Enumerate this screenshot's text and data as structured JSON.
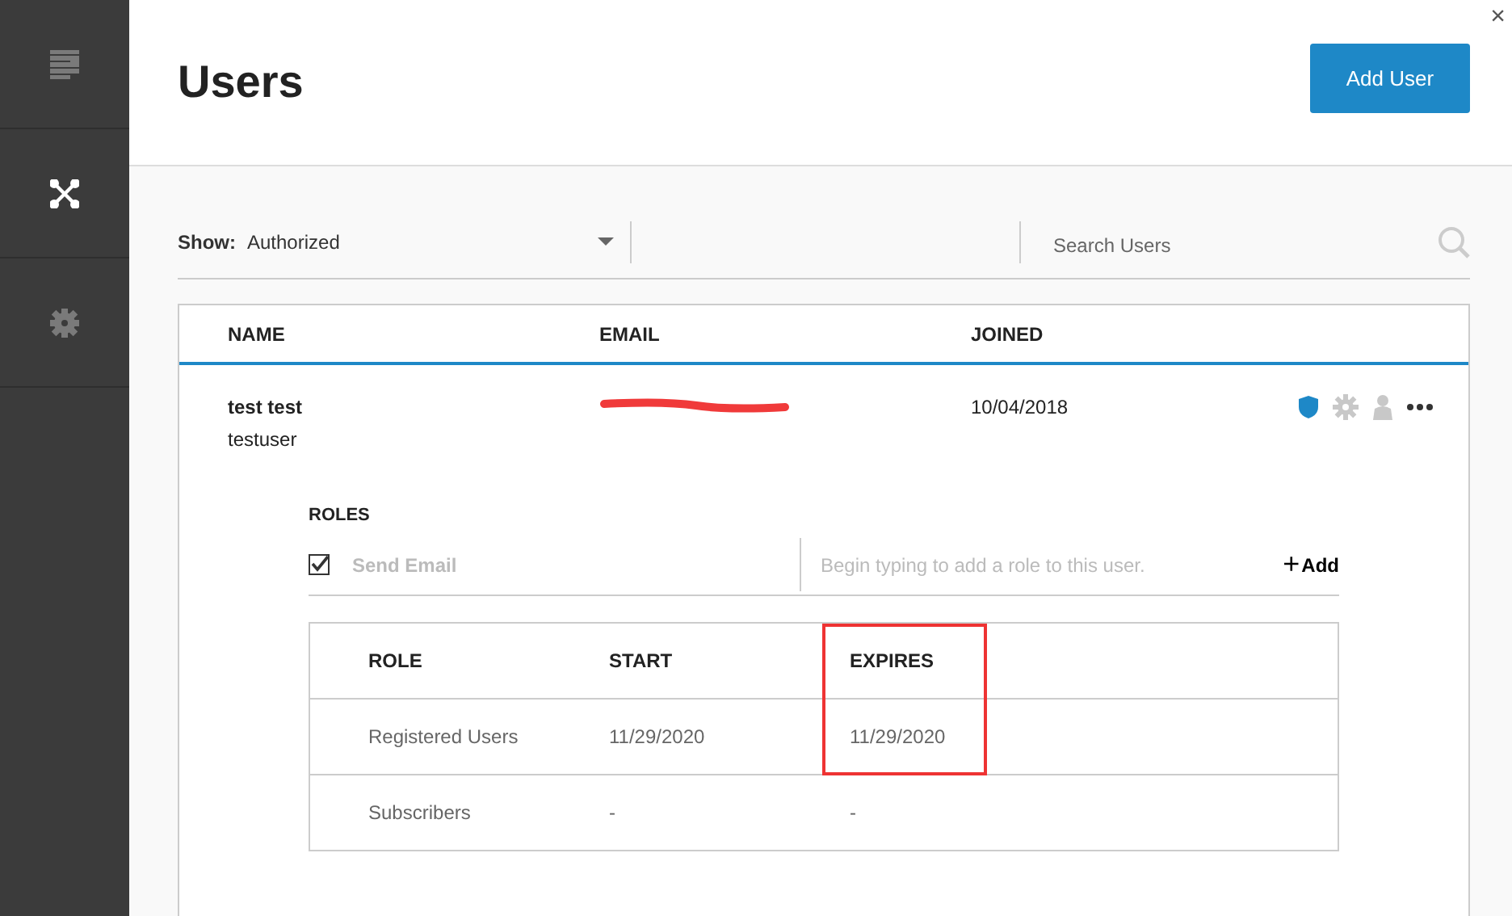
{
  "sidebar": {
    "items": [
      {
        "selected": false
      },
      {
        "selected": true
      },
      {
        "selected": false
      }
    ]
  },
  "header": {
    "title": "Users",
    "add_button": "Add User",
    "close": "×"
  },
  "filter": {
    "label": "Show:",
    "value": "Authorized",
    "search_placeholder": "Search Users"
  },
  "users_table": {
    "columns": [
      "NAME",
      "EMAIL",
      "JOINED"
    ],
    "rows": [
      {
        "name": "test test",
        "username": "testuser",
        "email_redacted": true,
        "joined": "10/04/2018",
        "expanded": true
      }
    ]
  },
  "roles": {
    "title": "ROLES",
    "send_email": {
      "label": "Send Email",
      "checked": true
    },
    "role_placeholder": "Begin typing to add a role to this user.",
    "add_label": "Add",
    "add_icon": "+",
    "columns": [
      {
        "label": "ROLE",
        "highlighted": false
      },
      {
        "label": "START",
        "highlighted": false
      },
      {
        "label": "EXPIRES",
        "highlighted": true
      }
    ],
    "rows": [
      {
        "role": "Registered Users",
        "start": "11/29/2020",
        "expires": "11/29/2020"
      },
      {
        "role": "Subscribers",
        "start": "-",
        "expires": "-"
      }
    ]
  }
}
